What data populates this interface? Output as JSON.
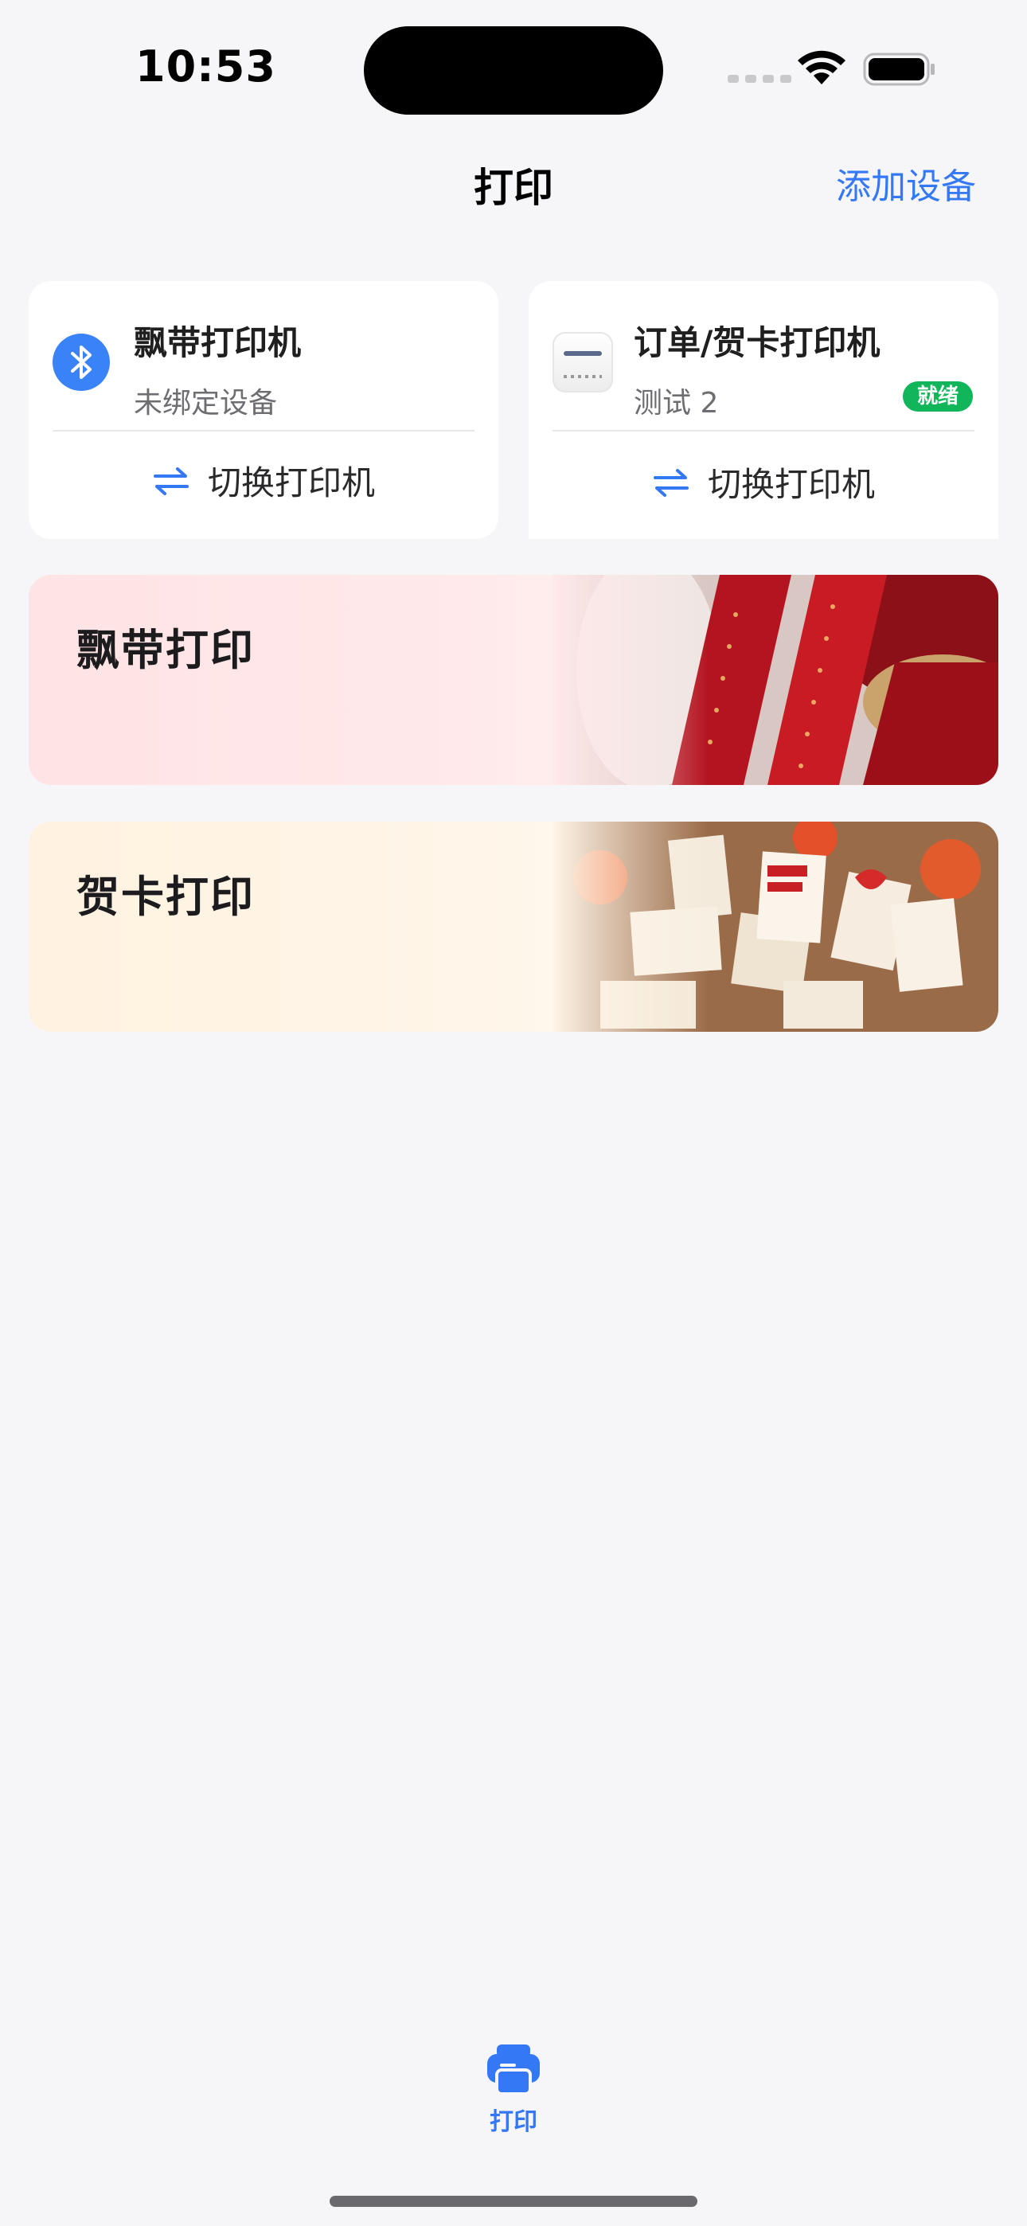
{
  "status_bar": {
    "time": "10:53"
  },
  "nav": {
    "title": "打印",
    "action": "添加设备"
  },
  "printers": [
    {
      "name": "飘带打印机",
      "status": "未绑定设备",
      "action": "切换打印机",
      "icon": "bluetooth-icon"
    },
    {
      "name": "订单/贺卡打印机",
      "status": "测试 2",
      "badge": "就绪",
      "action": "切换打印机",
      "icon": "printer-device-icon"
    }
  ],
  "features": [
    {
      "title": "飘带打印",
      "art": "ribbon-photo"
    },
    {
      "title": "贺卡打印",
      "art": "greeting-cards-photo"
    }
  ],
  "tabbar": {
    "items": [
      {
        "label": "打印",
        "icon": "printer-icon",
        "active": true
      }
    ]
  },
  "colors": {
    "accent": "#3478f6",
    "ready_badge": "#11b55a",
    "background": "#f6f6f9"
  }
}
